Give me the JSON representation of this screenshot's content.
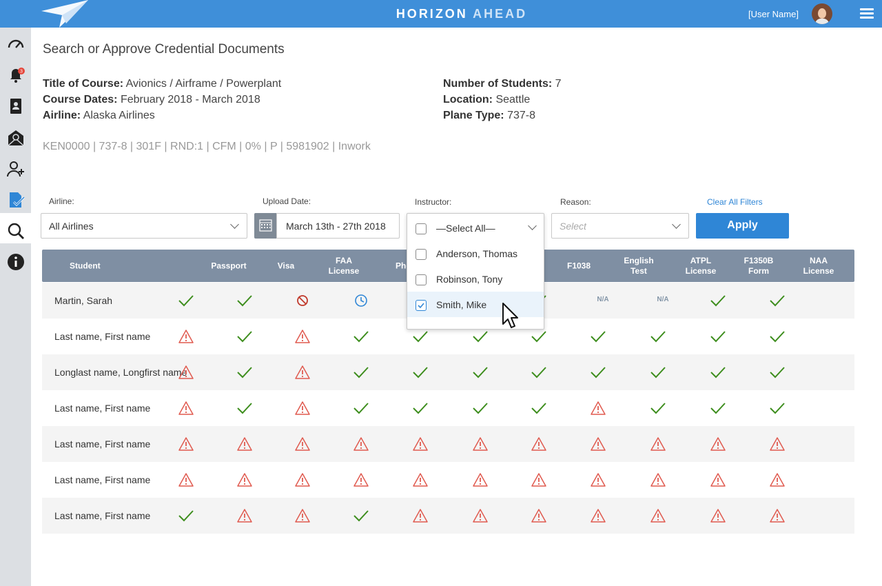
{
  "header": {
    "brand_part1": "HORIZON",
    "brand_part2": "AHEAD",
    "username": "[User Name]"
  },
  "sidebar": {
    "items": [
      "dashboard-icon",
      "notifications-icon",
      "contacts-icon",
      "email-icon",
      "add-user-icon",
      "documents-icon",
      "search-icon",
      "info-icon"
    ],
    "notification_count": "3"
  },
  "page": {
    "title": "Search or Approve Credential Documents",
    "course": {
      "title_label": "Title of Course:",
      "title_value": "Avionics / Airframe / Powerplant",
      "dates_label": "Course Dates:",
      "dates_value": "February 2018 - March 2018",
      "airline_label": "Airline:",
      "airline_value": "Alaska Airlines",
      "students_label": "Number of Students:",
      "students_value": "7",
      "location_label": "Location:",
      "location_value": "Seattle",
      "plane_label": "Plane Type:",
      "plane_value": "737-8"
    },
    "meta": "KEN0000 | 737-8 | 301F | RND:1  |  CFM |  0%  |  P  |  5981902  | Inwork"
  },
  "filters": {
    "airline_label": "Airline:",
    "airline_value": "All Airlines",
    "upload_label": "Upload Date:",
    "upload_value": "March 13th -  27th 2018",
    "instructor_label": "Instructor:",
    "reason_label": "Reason:",
    "reason_placeholder": "Select",
    "clear_all": "Clear All Filters",
    "apply": "Apply"
  },
  "instructor_dropdown": {
    "select_all": "—Select All—",
    "options": [
      {
        "label": "Anderson, Thomas",
        "checked": false
      },
      {
        "label": "Robinson, Tony",
        "checked": false
      },
      {
        "label": "Smith, Mike",
        "checked": true
      }
    ]
  },
  "table": {
    "headers": [
      "Student",
      "Passport",
      "Visa",
      "FAA License",
      "Pho",
      "",
      "",
      "F1038",
      "English Test",
      "ATPL License",
      "F1350B Form",
      "NAA License"
    ],
    "rows": [
      {
        "name": "Martin, Sarah",
        "status": [
          "check",
          "check",
          "ban",
          "clock",
          "",
          "",
          "check",
          "na",
          "na",
          "check",
          "check"
        ]
      },
      {
        "name": "Last name, First name",
        "status": [
          "warn",
          "check",
          "warn",
          "check",
          "check",
          "check",
          "check",
          "check",
          "check",
          "check",
          "check"
        ]
      },
      {
        "name": "Longlast name, Longfirst name",
        "status": [
          "warn",
          "check",
          "warn",
          "check",
          "check",
          "check",
          "check",
          "check",
          "check",
          "check",
          "check"
        ]
      },
      {
        "name": "Last name, First name",
        "status": [
          "warn",
          "check",
          "warn",
          "check",
          "check",
          "check",
          "check",
          "warn",
          "check",
          "check",
          "check"
        ]
      },
      {
        "name": "Last name, First name",
        "status": [
          "warn",
          "warn",
          "warn",
          "warn",
          "warn",
          "warn",
          "warn",
          "warn",
          "warn",
          "warn",
          "warn"
        ]
      },
      {
        "name": "Last name, First name",
        "status": [
          "warn",
          "warn",
          "warn",
          "warn",
          "warn",
          "warn",
          "warn",
          "warn",
          "warn",
          "warn",
          "warn"
        ]
      },
      {
        "name": "Last name, First name",
        "status": [
          "check",
          "warn",
          "warn",
          "check",
          "warn",
          "warn",
          "warn",
          "warn",
          "warn",
          "warn",
          "warn"
        ]
      }
    ],
    "na_text": "N/A"
  },
  "colors": {
    "brand": "#3f8fd9",
    "check": "#3e8e1e",
    "warn": "#e05a4f",
    "header": "#7f8fa3"
  }
}
